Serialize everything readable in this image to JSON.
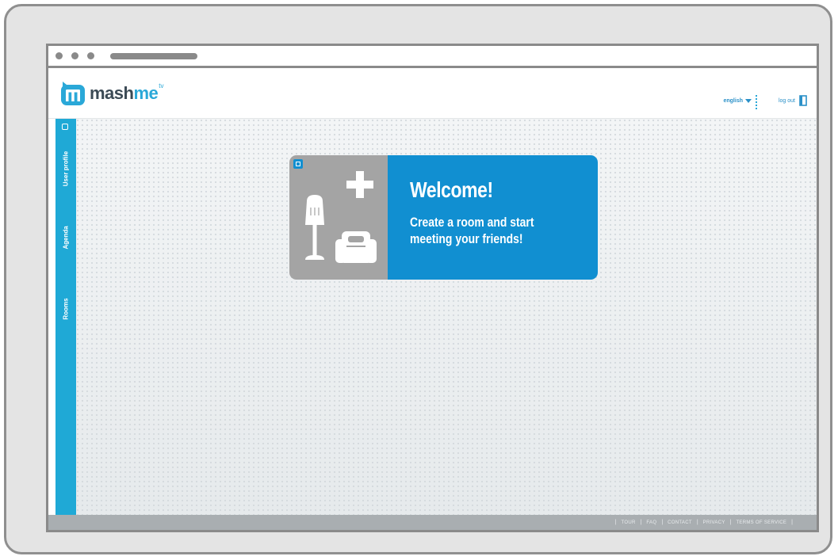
{
  "app": {
    "logo_text_main": "mash",
    "logo_text_accent": "me",
    "logo_tm": "tv",
    "brand_color": "#2aa8d8"
  },
  "header": {
    "language_label": "english",
    "logout_label": "log out"
  },
  "sidebar": {
    "items": [
      {
        "label": "User profile",
        "icon": "expand-icon"
      },
      {
        "label": "Agenda"
      },
      {
        "label": "Rooms"
      }
    ]
  },
  "welcome": {
    "title": "Welcome!",
    "line1": "Create a room and start",
    "line2": "meeting your friends!",
    "icons": [
      "plus-icon",
      "lamp-icon",
      "armchair-icon"
    ],
    "accent_color": "#118fd1"
  },
  "footer": {
    "links": [
      "TOUR",
      "FAQ",
      "CONTACT",
      "PRIVACY",
      "TERMS OF SERVICE"
    ]
  }
}
